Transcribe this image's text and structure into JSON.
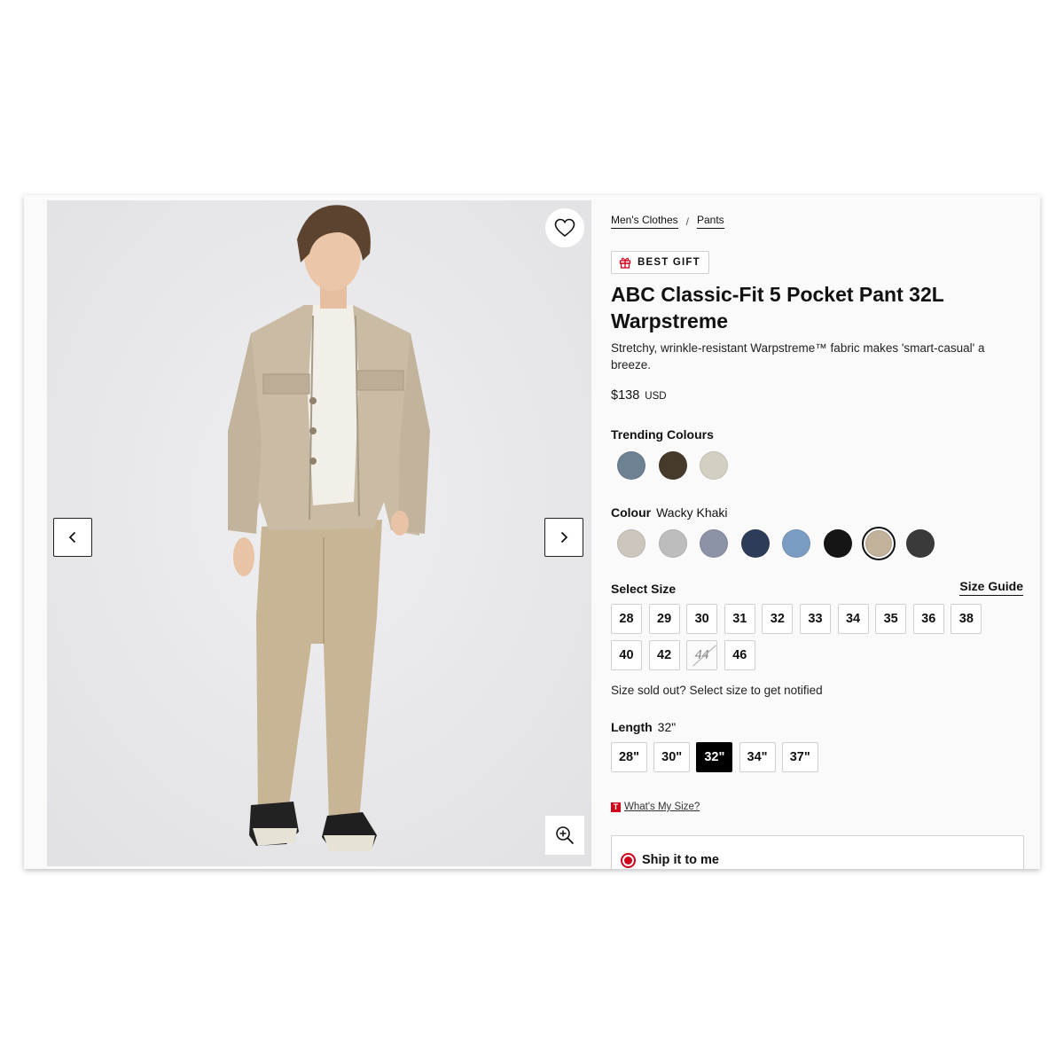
{
  "product": {
    "breadcrumb": [
      "Men's Clothes",
      "Pants"
    ],
    "badge": "BEST GIFT",
    "title": "ABC Classic-Fit 5 Pocket Pant 32L Warpstreme",
    "description": "Stretchy, wrinkle-resistant Warpstreme™ fabric makes 'smart-casual' a breeze.",
    "price": "$138",
    "currency": "USD"
  },
  "gallery": {
    "icons": [
      "heart-icon",
      "chevron-left-icon",
      "chevron-right-icon",
      "zoom-in-icon"
    ]
  },
  "trending": {
    "label": "Trending Colours",
    "swatches": [
      "#6e8193",
      "#463a2c",
      "#d3cfc2"
    ]
  },
  "colour": {
    "label": "Colour",
    "selected_name": "Wacky Khaki",
    "selected_index": 6,
    "swatches": [
      "#cdc6bd",
      "#bdbdbd",
      "#8c93a6",
      "#2d3d58",
      "#7b9cc2",
      "#151515",
      "#c3b29b",
      "#3a3a3a"
    ]
  },
  "size": {
    "label": "Select Size",
    "guide_label": "Size Guide",
    "row1": [
      "28",
      "29",
      "30",
      "31",
      "32",
      "33",
      "34",
      "35",
      "36",
      "38"
    ],
    "row2": [
      "40",
      "42",
      "44",
      "46"
    ],
    "sold_out": [
      "44"
    ],
    "note": "Size sold out? Select size to get notified"
  },
  "length": {
    "label": "Length",
    "selected": "32\"",
    "options": [
      "28\"",
      "30\"",
      "32\"",
      "34\"",
      "37\""
    ]
  },
  "whats_my_size": {
    "logo": "T",
    "label": "What's My Size?"
  },
  "shipping": {
    "label": "Ship it to me"
  },
  "colors": {
    "accent": "#d0021b",
    "gallery_bg": "#e9e9eb"
  }
}
